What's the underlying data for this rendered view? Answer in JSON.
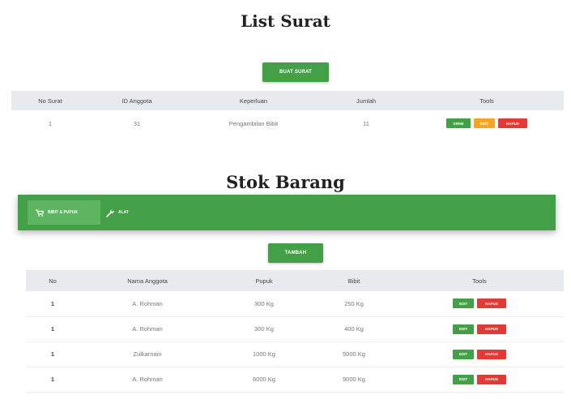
{
  "section1": {
    "title": "List Surat",
    "create_button": "BUAT SURAT",
    "columns": [
      "No Surat",
      "ID Anggota",
      "Keperluan",
      "Jumlah",
      "Tools"
    ],
    "rows": [
      {
        "no": "1",
        "id": "31",
        "keperluan": "Pengambilan Bibit",
        "jumlah": "11"
      }
    ],
    "row_actions": [
      "KIRIM",
      "EDIT",
      "HAPUS"
    ]
  },
  "section2": {
    "title": "Stok Barang",
    "nav": {
      "pupuk_label": "BIBIT & PUPUK",
      "alat_label": "ALAT"
    },
    "add_button": "TAMBAH",
    "columns": [
      "No",
      "Nama Anggota",
      "Pupuk",
      "Bibit",
      "Tools"
    ],
    "rows": [
      {
        "no": "1",
        "nama": "A. Rohman",
        "pupuk": "300 Kg",
        "bibit": "250 Kg"
      },
      {
        "no": "1",
        "nama": "A. Rohman",
        "pupuk": "300 Kg",
        "bibit": "400 Kg"
      },
      {
        "no": "1",
        "nama": "Zulkarnain",
        "pupuk": "1000 Kg",
        "bibit": "5000 Kg"
      },
      {
        "no": "1",
        "nama": "A. Rohman",
        "pupuk": "6000 Kg",
        "bibit": "9000 Kg"
      }
    ],
    "row_actions": [
      "EDIT",
      "HAPUS"
    ]
  },
  "colors": {
    "green": "#43a047",
    "orange": "#f5a623",
    "red": "#e53935",
    "header_bg": "#e8ebed"
  },
  "icons": {
    "cart": "cart-icon",
    "wrench": "wrench-icon"
  }
}
